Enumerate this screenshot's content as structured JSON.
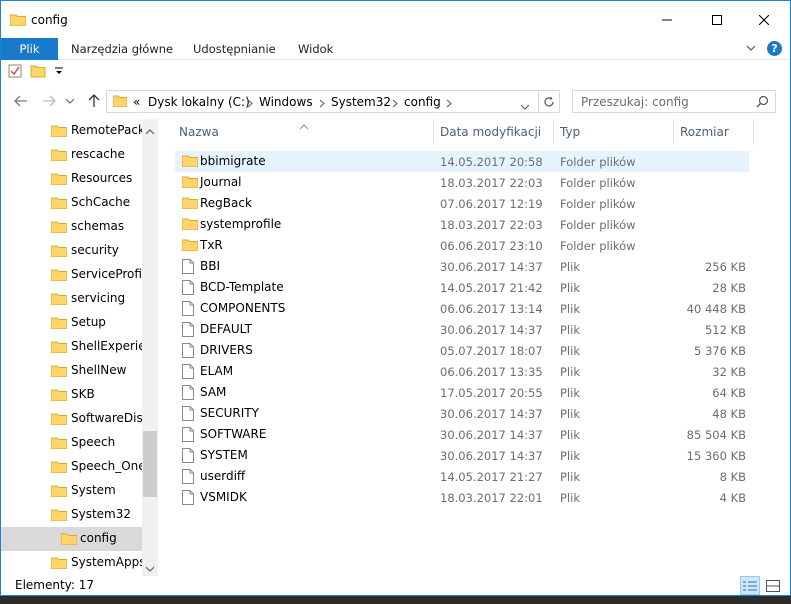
{
  "title": "config",
  "ribbon": {
    "file_tab": "Plik",
    "tabs": [
      "Narzędzia główne",
      "Udostępnianie",
      "Widok"
    ],
    "help": "?"
  },
  "address": {
    "overflow": "«",
    "breadcrumb": [
      "Dysk lokalny (C:)",
      "Windows",
      "System32",
      "config"
    ]
  },
  "search": {
    "placeholder": "Przeszukaj: config"
  },
  "nav": {
    "items": [
      {
        "label": "RemotePackages",
        "selected": false
      },
      {
        "label": "rescache",
        "selected": false
      },
      {
        "label": "Resources",
        "selected": false
      },
      {
        "label": "SchCache",
        "selected": false
      },
      {
        "label": "schemas",
        "selected": false
      },
      {
        "label": "security",
        "selected": false
      },
      {
        "label": "ServiceProfiles",
        "selected": false
      },
      {
        "label": "servicing",
        "selected": false
      },
      {
        "label": "Setup",
        "selected": false
      },
      {
        "label": "ShellExperiences",
        "selected": false
      },
      {
        "label": "ShellNew",
        "selected": false
      },
      {
        "label": "SKB",
        "selected": false
      },
      {
        "label": "SoftwareDistribution",
        "selected": false
      },
      {
        "label": "Speech",
        "selected": false
      },
      {
        "label": "Speech_OneCore",
        "selected": false
      },
      {
        "label": "System",
        "selected": false
      },
      {
        "label": "System32",
        "selected": false
      },
      {
        "label": "config",
        "selected": true
      },
      {
        "label": "SystemApps",
        "selected": false
      }
    ]
  },
  "columns": {
    "name": "Nazwa",
    "date": "Data modyfikacji",
    "type": "Typ",
    "size": "Rozmiar"
  },
  "files": [
    {
      "name": "bbimigrate",
      "date": "14.05.2017 20:58",
      "type": "Folder plików",
      "size": "",
      "kind": "folder",
      "selected": true
    },
    {
      "name": "Journal",
      "date": "18.03.2017 22:03",
      "type": "Folder plików",
      "size": "",
      "kind": "folder",
      "selected": false
    },
    {
      "name": "RegBack",
      "date": "07.06.2017 12:19",
      "type": "Folder plików",
      "size": "",
      "kind": "folder",
      "selected": false
    },
    {
      "name": "systemprofile",
      "date": "18.03.2017 22:03",
      "type": "Folder plików",
      "size": "",
      "kind": "folder",
      "selected": false
    },
    {
      "name": "TxR",
      "date": "06.06.2017 23:10",
      "type": "Folder plików",
      "size": "",
      "kind": "folder",
      "selected": false
    },
    {
      "name": "BBI",
      "date": "30.06.2017 14:37",
      "type": "Plik",
      "size": "256 KB",
      "kind": "file",
      "selected": false
    },
    {
      "name": "BCD-Template",
      "date": "14.05.2017 21:42",
      "type": "Plik",
      "size": "28 KB",
      "kind": "file",
      "selected": false
    },
    {
      "name": "COMPONENTS",
      "date": "06.06.2017 13:14",
      "type": "Plik",
      "size": "40 448 KB",
      "kind": "file",
      "selected": false
    },
    {
      "name": "DEFAULT",
      "date": "30.06.2017 14:37",
      "type": "Plik",
      "size": "512 KB",
      "kind": "file",
      "selected": false
    },
    {
      "name": "DRIVERS",
      "date": "05.07.2017 18:07",
      "type": "Plik",
      "size": "5 376 KB",
      "kind": "file",
      "selected": false
    },
    {
      "name": "ELAM",
      "date": "06.06.2017 13:35",
      "type": "Plik",
      "size": "32 KB",
      "kind": "file",
      "selected": false
    },
    {
      "name": "SAM",
      "date": "17.05.2017 20:55",
      "type": "Plik",
      "size": "64 KB",
      "kind": "file",
      "selected": false
    },
    {
      "name": "SECURITY",
      "date": "30.06.2017 14:37",
      "type": "Plik",
      "size": "48 KB",
      "kind": "file",
      "selected": false
    },
    {
      "name": "SOFTWARE",
      "date": "30.06.2017 14:37",
      "type": "Plik",
      "size": "85 504 KB",
      "kind": "file",
      "selected": false
    },
    {
      "name": "SYSTEM",
      "date": "30.06.2017 14:37",
      "type": "Plik",
      "size": "15 360 KB",
      "kind": "file",
      "selected": false
    },
    {
      "name": "userdiff",
      "date": "14.05.2017 21:27",
      "type": "Plik",
      "size": "8 KB",
      "kind": "file",
      "selected": false
    },
    {
      "name": "VSMIDK",
      "date": "18.03.2017 22:01",
      "type": "Plik",
      "size": "4 KB",
      "kind": "file",
      "selected": false
    }
  ],
  "status": {
    "count": "Elementy: 17"
  },
  "colors": {
    "accent": "#1979ca",
    "selection": "#e5f3ff",
    "folder": "#ffd56b",
    "nav_selected": "#d9d9d9"
  }
}
